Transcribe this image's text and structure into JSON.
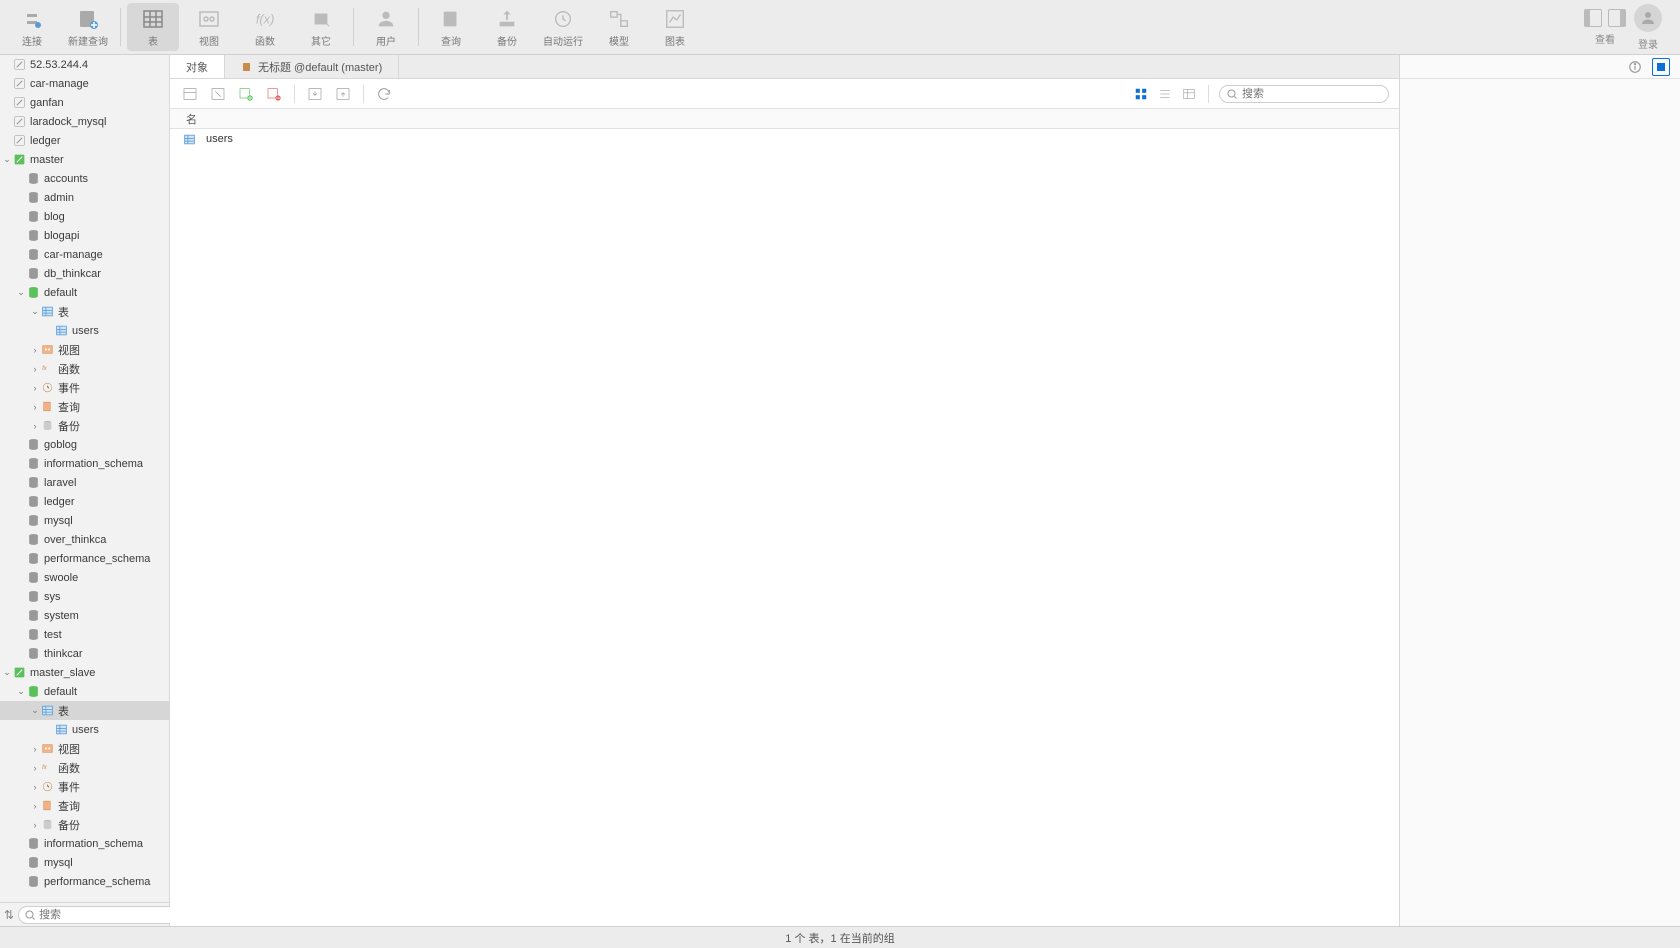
{
  "toolbar": {
    "connect": "连接",
    "new_query": "新建查询",
    "table": "表",
    "view": "视图",
    "function": "函数",
    "other": "其它",
    "user": "用户",
    "query": "查询",
    "backup": "备份",
    "auto_run": "自动运行",
    "model": "模型",
    "chart": "图表",
    "view_label": "查看",
    "login": "登录"
  },
  "tree_labels": {
    "tables": "表",
    "views": "视图",
    "functions": "函数",
    "events": "事件",
    "queries": "查询",
    "backups": "备份"
  },
  "connections": [
    {
      "name": "52.53.244.4",
      "on ok": false
    },
    {
      "name": "car-manage",
      "ok": false
    },
    {
      "name": "ganfan",
      "ok": false
    },
    {
      "name": "laradock_mysql",
      "ok": false
    },
    {
      "name": "ledger",
      "ok": false
    }
  ],
  "master": {
    "name": "master",
    "databases_top": [
      "accounts",
      "admin",
      "blog",
      "blogapi",
      "car-manage",
      "db_thinkcar"
    ],
    "default_db": "default",
    "default_tables": [
      "users"
    ],
    "databases_bottom": [
      "goblog",
      "information_schema",
      "laravel",
      "ledger",
      "mysql",
      "over_thinkca",
      "performance_schema",
      "swoole",
      "sys",
      "system",
      "test",
      "thinkcar"
    ]
  },
  "master_slave": {
    "name": "master_slave",
    "default_db": "default",
    "default_tables": [
      "users"
    ],
    "databases_bottom": [
      "information_schema",
      "mysql",
      "performance_schema"
    ]
  },
  "search_placeholder": "搜索",
  "tabs": {
    "objects": "对象",
    "untitled": "无标题 @default (master)"
  },
  "column_name": "名",
  "list_rows": [
    "users"
  ],
  "statusbar": "1 个 表，1 在当前的组"
}
